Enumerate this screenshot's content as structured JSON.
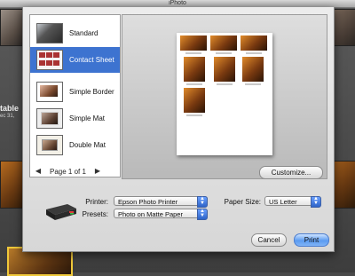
{
  "window": {
    "title": "iPhoto"
  },
  "background": {
    "event_title": "table",
    "event_date": "ec 31,"
  },
  "themes": [
    {
      "label": "Standard",
      "icon": "standard-theme-thumbnail",
      "selected": false
    },
    {
      "label": "Contact Sheet",
      "icon": "contact-sheet-thumbnail",
      "selected": true
    },
    {
      "label": "Simple Border",
      "icon": "simple-border-thumbnail",
      "selected": false
    },
    {
      "label": "Simple Mat",
      "icon": "simple-mat-thumbnail",
      "selected": false
    },
    {
      "label": "Double Mat",
      "icon": "double-mat-thumbnail",
      "selected": false
    }
  ],
  "preview": {
    "page_label": "Page 1 of 1",
    "prev_icon": "left-arrow-icon",
    "next_icon": "right-arrow-icon",
    "customize_label": "Customize..."
  },
  "settings": {
    "printer_label": "Printer:",
    "printer_value": "Epson Photo Printer",
    "presets_label": "Presets:",
    "presets_value": "Photo on Matte Paper",
    "paper_size_label": "Paper Size:",
    "paper_size_value": "US Letter"
  },
  "buttons": {
    "cancel_label": "Cancel",
    "print_label": "Print"
  },
  "colors": {
    "selection": "#3d73d0",
    "default_button": "#5b9bf0"
  }
}
